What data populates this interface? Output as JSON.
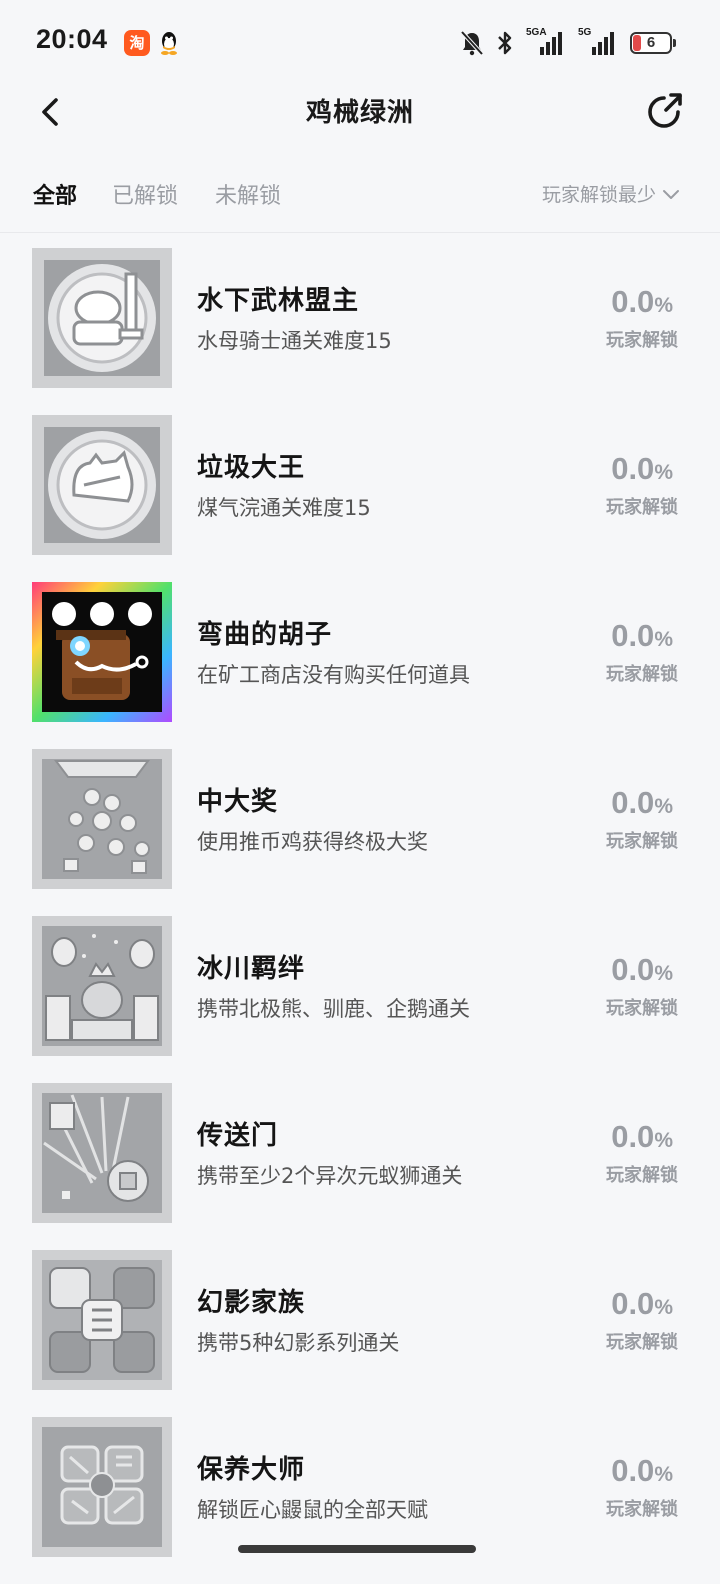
{
  "status_bar": {
    "time": "20:04",
    "taobao_icon_text": "淘",
    "signal_1_label": "5GA",
    "signal_2_label": "5G",
    "battery_level": "6",
    "icons": [
      "taobao-icon",
      "qq-icon",
      "mute-icon",
      "bluetooth-icon",
      "signal-icon",
      "signal-icon",
      "battery-icon"
    ]
  },
  "header": {
    "title": "鸡械绿洲",
    "back_icon": "chevron-left-icon",
    "share_icon": "share-icon"
  },
  "tabs": {
    "all": "全部",
    "unlocked": "已解锁",
    "locked": "未解锁",
    "active": "all"
  },
  "sort": {
    "label": "玩家解锁最少",
    "icon": "chevron-down-icon"
  },
  "achievements": [
    {
      "name": "水下武林盟主",
      "desc": "水母骑士通关难度15",
      "percent": "0.0",
      "percent_sign": "%",
      "unlock_label": "玩家解锁",
      "locked": true,
      "icon": "knight-badge-icon"
    },
    {
      "name": "垃圾大王",
      "desc": "煤气浣通关难度15",
      "percent": "0.0",
      "percent_sign": "%",
      "unlock_label": "玩家解锁",
      "locked": true,
      "icon": "raccoon-badge-icon"
    },
    {
      "name": "弯曲的胡子",
      "desc": "在矿工商店没有购买任何道具",
      "percent": "0.0",
      "percent_sign": "%",
      "unlock_label": "玩家解锁",
      "locked": false,
      "icon": "miner-mustache-icon"
    },
    {
      "name": "中大奖",
      "desc": "使用推币鸡获得终极大奖",
      "percent": "0.0",
      "percent_sign": "%",
      "unlock_label": "玩家解锁",
      "locked": true,
      "icon": "coin-pusher-icon"
    },
    {
      "name": "冰川羁绊",
      "desc": "携带北极熊、驯鹿、企鹅通关",
      "percent": "0.0",
      "percent_sign": "%",
      "unlock_label": "玩家解锁",
      "locked": true,
      "icon": "glacier-icon"
    },
    {
      "name": "传送门",
      "desc": "携带至少2个异次元蚁狮通关",
      "percent": "0.0",
      "percent_sign": "%",
      "unlock_label": "玩家解锁",
      "locked": true,
      "icon": "portal-icon"
    },
    {
      "name": "幻影家族",
      "desc": "携带5种幻影系列通关",
      "percent": "0.0",
      "percent_sign": "%",
      "unlock_label": "玩家解锁",
      "locked": true,
      "icon": "phantom-family-icon"
    },
    {
      "name": "保养大师",
      "desc": "解锁匠心鼹鼠的全部天赋",
      "percent": "0.0",
      "percent_sign": "%",
      "unlock_label": "玩家解锁",
      "locked": true,
      "icon": "tools-icon"
    }
  ]
}
